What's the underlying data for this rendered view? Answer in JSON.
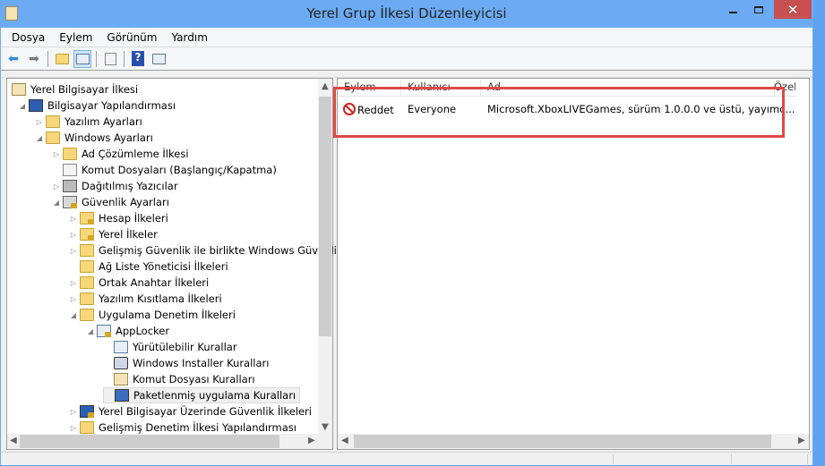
{
  "window": {
    "title": "Yerel Grup İlkesi Düzenleyicisi",
    "minimize": "minimize",
    "maximize": "maximize",
    "close": "✕"
  },
  "menu": [
    "Dosya",
    "Eylem",
    "Görünüm",
    "Yardım"
  ],
  "toolbar": [
    "back-icon",
    "forward-icon",
    "up-folder-icon",
    "show-hide-tree-icon",
    "export-list-icon",
    "help-icon",
    "show-hide-action-pane-icon"
  ],
  "tree": [
    {
      "label": "Yerel Bilgisayar İlkesi",
      "level": 0,
      "expander": "",
      "icon": "scroll"
    },
    {
      "label": "Bilgisayar Yapılandırması",
      "level": 1,
      "expander": "open",
      "icon": "pc"
    },
    {
      "label": "Yazılım Ayarları",
      "level": 2,
      "expander": "closed",
      "icon": "folder"
    },
    {
      "label": "Windows Ayarları",
      "level": 2,
      "expander": "open",
      "icon": "folder"
    },
    {
      "label": "Ad Çözümleme İlkesi",
      "level": 3,
      "expander": "closed",
      "icon": "folder"
    },
    {
      "label": "Komut Dosyaları (Başlangıç/Kapatma)",
      "level": 3,
      "expander": "",
      "icon": "doc"
    },
    {
      "label": "Dağıtılmış Yazıcılar",
      "level": 3,
      "expander": "closed",
      "icon": "printer"
    },
    {
      "label": "Güvenlik Ayarları",
      "level": 3,
      "expander": "open",
      "icon": "server lock"
    },
    {
      "label": "Hesap İlkeleri",
      "level": 4,
      "expander": "closed",
      "icon": "folder lock"
    },
    {
      "label": "Yerel İlkeler",
      "level": 4,
      "expander": "closed",
      "icon": "folder lock"
    },
    {
      "label": "Gelişmiş Güvenlik ile birlikte Windows Güvenlik",
      "level": 4,
      "expander": "closed",
      "icon": "folder"
    },
    {
      "label": "Ağ Liste Yöneticisi İlkeleri",
      "level": 4,
      "expander": "",
      "icon": "folder"
    },
    {
      "label": "Ortak Anahtar İlkeleri",
      "level": 4,
      "expander": "closed",
      "icon": "folder"
    },
    {
      "label": "Yazılım Kısıtlama İlkeleri",
      "level": 4,
      "expander": "closed",
      "icon": "folder"
    },
    {
      "label": "Uygulama Denetim İlkeleri",
      "level": 4,
      "expander": "open",
      "icon": "folder"
    },
    {
      "label": "AppLocker",
      "level": 5,
      "expander": "open",
      "icon": "winic lock"
    },
    {
      "label": "Yürütülebilir Kurallar",
      "level": 6,
      "expander": "",
      "icon": "winic"
    },
    {
      "label": "Windows Installer Kuralları",
      "level": 6,
      "expander": "",
      "icon": "disc"
    },
    {
      "label": "Komut Dosyası Kuralları",
      "level": 6,
      "expander": "",
      "icon": "scroll"
    },
    {
      "label": "Paketlenmiş uygulama Kuralları",
      "level": 6,
      "expander": "",
      "icon": "pkg",
      "selected": true
    },
    {
      "label": "Yerel Bilgisayar Üzerinde Güvenlik İlkeleri",
      "level": 4,
      "expander": "closed",
      "icon": "pc lock"
    },
    {
      "label": "Gelişmiş Denetim İlkesi Yapılandırması",
      "level": 4,
      "expander": "closed",
      "icon": "folder"
    }
  ],
  "list": {
    "columns": [
      "Eylem",
      "Kullanıcı",
      "Ad",
      "Özel du"
    ],
    "rows": [
      {
        "action": "Reddet",
        "user": "Everyone",
        "name": "Microsoft.XboxLIVEGames, sürüm 1.0.0.0 ve üstü, yayımc..."
      }
    ]
  },
  "colors": {
    "highlight": "#e04848",
    "titlebar": "#6cabf3",
    "close": "#c75050"
  }
}
